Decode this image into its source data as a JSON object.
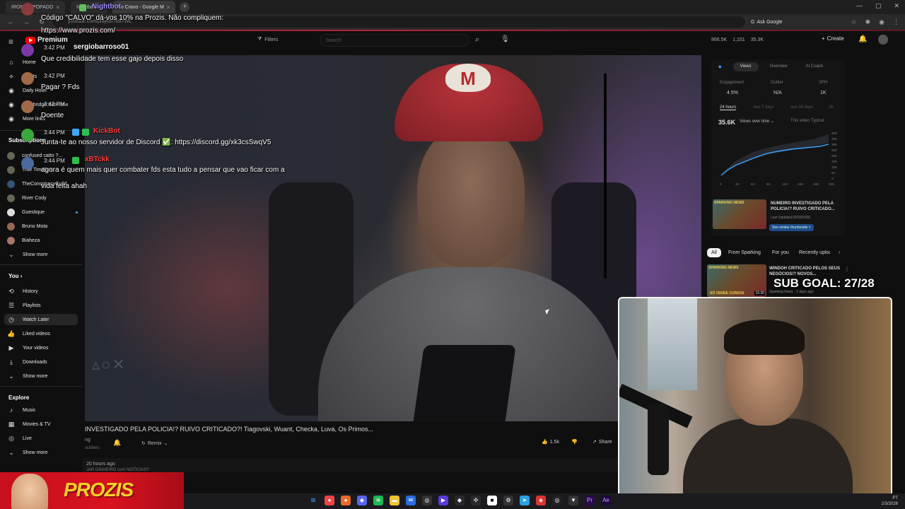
{
  "browser": {
    "tabs": [
      {
        "label": "IROMER POPADO"
      },
      {
        "label": "Nightbot"
      },
      {
        "label": "do Cravo - Google M"
      }
    ],
    "address": "youtube.com/playlist?list=WL",
    "ask_google": "Ask Google"
  },
  "header": {
    "logo": "Premium",
    "filters": "Filters",
    "search_placeholder": "Search",
    "stats": [
      "866.5K",
      "1,151",
      "35.3K"
    ],
    "create": "Create"
  },
  "sidebar": {
    "top_items": [
      {
        "label": "Home",
        "icon": "home-icon"
      },
      {
        "label": "Shorts",
        "icon": "shorts-icon"
      },
      {
        "label": "Daily Hotel",
        "icon": "channel-icon"
      },
      {
        "label": "Cambridge Interview",
        "icon": "channel-icon"
      },
      {
        "label": "More links",
        "icon": "channel-icon"
      }
    ],
    "subscriptions_head": "Subscriptions",
    "subscriptions": [
      {
        "label": "confused catto ?..."
      },
      {
        "label": "True Timeline"
      },
      {
        "label": "TheConspiracyGuild"
      },
      {
        "label": "River Cody"
      },
      {
        "label": "Guestique"
      },
      {
        "label": "Bruno Mota"
      },
      {
        "label": "Biaheza"
      }
    ],
    "show_more_1": "Show more",
    "you_head": "You",
    "you_items": [
      {
        "label": "History",
        "icon": "history-icon"
      },
      {
        "label": "Playlists",
        "icon": "playlists-icon"
      },
      {
        "label": "Watch Later",
        "icon": "clock-icon"
      },
      {
        "label": "Liked videos",
        "icon": "like-icon"
      },
      {
        "label": "Your videos",
        "icon": "video-icon"
      },
      {
        "label": "Downloads",
        "icon": "download-icon"
      }
    ],
    "show_more_2": "Show more",
    "explore_head": "Explore",
    "explore_items": [
      {
        "label": "Music",
        "icon": "music-icon"
      },
      {
        "label": "Movies & TV",
        "icon": "film-icon"
      },
      {
        "label": "Live",
        "icon": "live-icon"
      }
    ],
    "show_more_3": "Show more"
  },
  "video": {
    "title": "INVESTIGADO PELA POLICIA!? RUIVO CRITICADO?! Tiagovski, Wuant, Checka, Luva, Os Primos...",
    "channel": "ng",
    "subscribers": "scribers",
    "remix": "Remix",
    "likes": "1.5k",
    "share": "Share",
    "time_ago": "20 hours ago",
    "desc": "JAR DINHEIRO com NOTICIAS? "
  },
  "analytics": {
    "tabs": [
      "Views",
      "Overview",
      "AI Coach"
    ],
    "metrics": [
      {
        "label": "Engagement",
        "value": "4.5%"
      },
      {
        "label": "Outlier",
        "value": "N/A"
      },
      {
        "label": "VPH",
        "value": "1K"
      }
    ],
    "periods": [
      "24 hours",
      "last 7 days",
      "last 28 days",
      "All"
    ],
    "views_total": "35.6K",
    "views_selector": "Views over time",
    "legend": "This video  Typical",
    "y_ticks": [
      "40K",
      "35K",
      "30K",
      "25K",
      "20K",
      "15K",
      "10K",
      "5K",
      "0"
    ],
    "x_ticks": [
      "0",
      "3H",
      "6H",
      "9H",
      "12H",
      "15H",
      "18H",
      "20H"
    ],
    "rec1": {
      "title": "NUMEIRO INVESTIGADO PELA POLICIA!? RUIVO CRITICADO...",
      "meta": "Last Updated 02/03/2026",
      "tag": "SPARKING NEWS",
      "button": "See similar thumbnails"
    },
    "chips": [
      "All",
      "From Sparking",
      "For you",
      "Recently uploaded"
    ],
    "rec2": {
      "title": "WINDOH CRITICADO PELOS SEUS NEGÓCIOS!? NOVOS...",
      "meta": "Sparking News · 2 days ago",
      "tag": "SPARKING NEWS",
      "duration": "15:30",
      "caption": "SÓ VENDE CURSOS"
    }
  },
  "overlay": {
    "sub_goal": "SUB GOAL: 27/28",
    "chat": [
      {
        "user": "Nightbot",
        "time": "",
        "text": "Código \"CALVO\" dá-vos 10% na Prozis. Não compliquem:",
        "text2": "https://www.prozis.com/",
        "color": "#9b8cff"
      },
      {
        "user": "sergiobarroso01",
        "time": "3:42 PM",
        "text": "Que credibilidade tem esse gajo depois disso",
        "color": "#ffffff"
      },
      {
        "user": "",
        "time": "3:42 PM",
        "text": "Pagar ? Fds",
        "color": "#3ea6ff"
      },
      {
        "user": "",
        "time": "3:42 PM",
        "text": "Doente",
        "color": "#3ea6ff"
      },
      {
        "user": "KickBot",
        "time": "3:44 PM",
        "text": "Junta-te ao nosso servidor de Discord ✅: https://discord.gg/xk3csSwqV5",
        "color": "#ff3b3b"
      },
      {
        "user": "xBTckk",
        "time": "3:44 PM",
        "text": "agora é quem mais quer combater fds esta tudo a pensar que vao ficar com a",
        "text2": "vida feita ahah",
        "color": "#ff3b3b"
      }
    ],
    "prozis": "PROZIS"
  },
  "taskbar": {
    "lang": "PT",
    "clock_time": "",
    "clock_date": "2/3/2026"
  }
}
